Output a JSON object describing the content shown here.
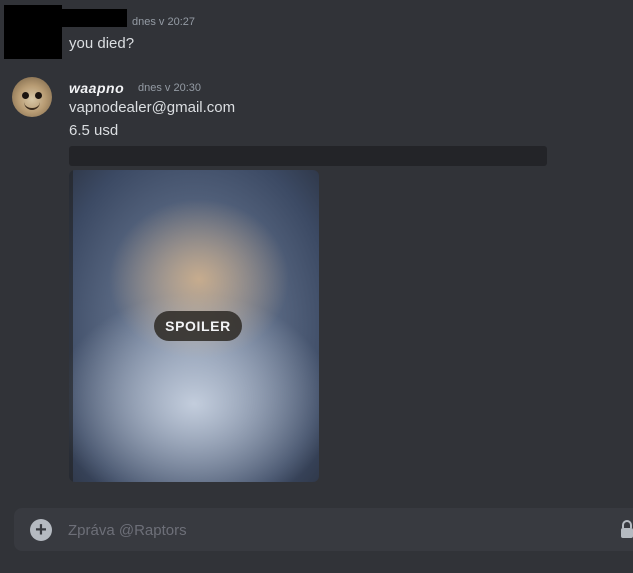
{
  "messages": [
    {
      "timestamp": "dnes v 20:27",
      "lines": [
        "you died?"
      ]
    },
    {
      "author": "waapno",
      "timestamp": "dnes v 20:30",
      "lines": [
        "vapnodealer@gmail.com",
        "6.5 usd"
      ],
      "attachment": {
        "spoiler_label": "SPOILER"
      }
    }
  ],
  "composer": {
    "placeholder": "Zpráva @Raptors",
    "value": ""
  },
  "colors": {
    "background": "#313338",
    "composer": "#383a40",
    "text": "#dbdee1",
    "muted": "#949ba4"
  },
  "icons": {
    "composer_add": "plus-circle-icon",
    "composer_right": "lock-icon"
  }
}
